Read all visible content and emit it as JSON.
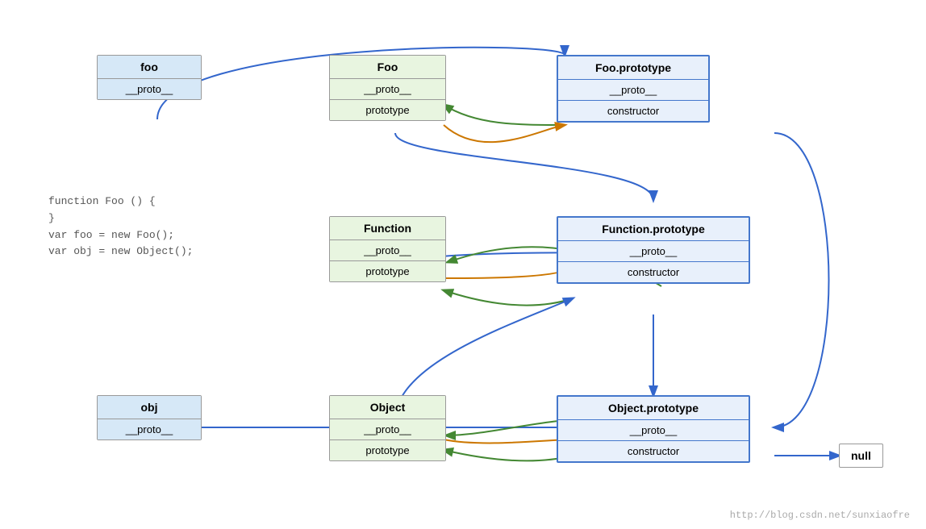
{
  "boxes": {
    "foo": {
      "title": "foo",
      "fields": [
        "__proto__"
      ]
    },
    "Foo": {
      "title": "Foo",
      "fields": [
        "__proto__",
        "prototype"
      ]
    },
    "FooPrototype": {
      "title": "Foo.prototype",
      "fields": [
        "__proto__",
        "constructor"
      ]
    },
    "Function": {
      "title": "Function",
      "fields": [
        "__proto__",
        "prototype"
      ]
    },
    "FunctionPrototype": {
      "title": "Function.prototype",
      "fields": [
        "__proto__",
        "constructor"
      ]
    },
    "obj": {
      "title": "obj",
      "fields": [
        "__proto__"
      ]
    },
    "Object": {
      "title": "Object",
      "fields": [
        "__proto__",
        "prototype"
      ]
    },
    "ObjectPrototype": {
      "title": "Object.prototype",
      "fields": [
        "__proto__",
        "constructor"
      ]
    },
    "null": {
      "title": "null"
    }
  },
  "code": {
    "lines": [
      "function Foo () {",
      "}",
      "var foo = new Foo();",
      "var obj = new Object();"
    ]
  },
  "attribution": "http://blog.csdn.net/sunxiaofre"
}
